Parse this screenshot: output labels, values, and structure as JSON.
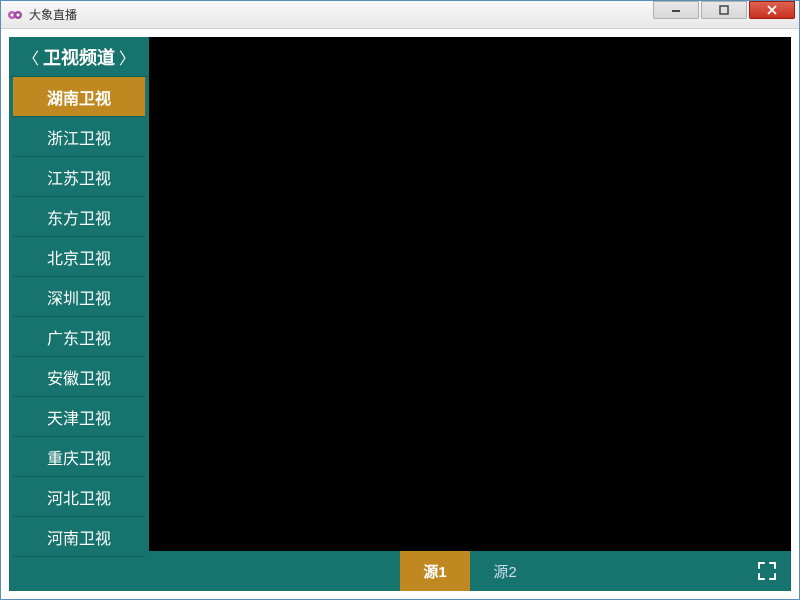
{
  "titlebar": {
    "app_title": "大象直播"
  },
  "sidebar": {
    "category_label": "卫视频道",
    "channels": [
      {
        "label": "湖南卫视",
        "selected": true
      },
      {
        "label": "浙江卫视",
        "selected": false
      },
      {
        "label": "江苏卫视",
        "selected": false
      },
      {
        "label": "东方卫视",
        "selected": false
      },
      {
        "label": "北京卫视",
        "selected": false
      },
      {
        "label": "深圳卫视",
        "selected": false
      },
      {
        "label": "广东卫视",
        "selected": false
      },
      {
        "label": "安徽卫视",
        "selected": false
      },
      {
        "label": "天津卫视",
        "selected": false
      },
      {
        "label": "重庆卫视",
        "selected": false
      },
      {
        "label": "河北卫视",
        "selected": false
      },
      {
        "label": "河南卫视",
        "selected": false
      }
    ]
  },
  "sources": {
    "tabs": [
      {
        "label": "源1",
        "selected": true
      },
      {
        "label": "源2",
        "selected": false
      }
    ]
  },
  "colors": {
    "teal": "#17736e",
    "teal_dark": "#0f5f5a",
    "orange": "#c08820",
    "close_red": "#c83020"
  }
}
